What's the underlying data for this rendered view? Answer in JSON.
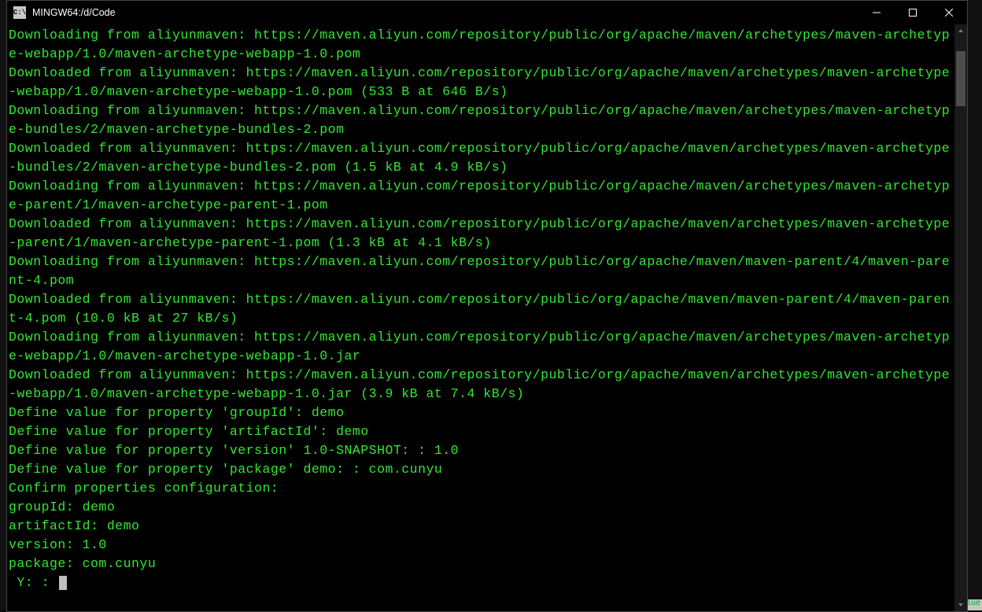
{
  "titlebar": {
    "icon_label": "C:\\",
    "title": "MINGW64:/d/Code"
  },
  "terminal": {
    "lines": [
      "Downloading from aliyunmaven: https://maven.aliyun.com/repository/public/org/apache/maven/archetypes/maven-archetype-webapp/1.0/maven-archetype-webapp-1.0.pom",
      "Downloaded from aliyunmaven: https://maven.aliyun.com/repository/public/org/apache/maven/archetypes/maven-archetype-webapp/1.0/maven-archetype-webapp-1.0.pom (533 B at 646 B/s)",
      "Downloading from aliyunmaven: https://maven.aliyun.com/repository/public/org/apache/maven/archetypes/maven-archetype-bundles/2/maven-archetype-bundles-2.pom",
      "Downloaded from aliyunmaven: https://maven.aliyun.com/repository/public/org/apache/maven/archetypes/maven-archetype-bundles/2/maven-archetype-bundles-2.pom (1.5 kB at 4.9 kB/s)",
      "Downloading from aliyunmaven: https://maven.aliyun.com/repository/public/org/apache/maven/archetypes/maven-archetype-parent/1/maven-archetype-parent-1.pom",
      "Downloaded from aliyunmaven: https://maven.aliyun.com/repository/public/org/apache/maven/archetypes/maven-archetype-parent/1/maven-archetype-parent-1.pom (1.3 kB at 4.1 kB/s)",
      "Downloading from aliyunmaven: https://maven.aliyun.com/repository/public/org/apache/maven/maven-parent/4/maven-parent-4.pom",
      "Downloaded from aliyunmaven: https://maven.aliyun.com/repository/public/org/apache/maven/maven-parent/4/maven-parent-4.pom (10.0 kB at 27 kB/s)",
      "Downloading from aliyunmaven: https://maven.aliyun.com/repository/public/org/apache/maven/archetypes/maven-archetype-webapp/1.0/maven-archetype-webapp-1.0.jar",
      "Downloaded from aliyunmaven: https://maven.aliyun.com/repository/public/org/apache/maven/archetypes/maven-archetype-webapp/1.0/maven-archetype-webapp-1.0.jar (3.9 kB at 7.4 kB/s)",
      "Define value for property 'groupId': demo",
      "Define value for property 'artifactId': demo",
      "Define value for property 'version' 1.0-SNAPSHOT: : 1.0",
      "Define value for property 'package' demo: : com.cunyu",
      "Confirm properties configuration:",
      "groupId: demo",
      "artifactId: demo",
      "version: 1.0",
      "package: com.cunyu",
      " Y: : "
    ]
  },
  "background": {
    "bottom_label": "Define value"
  }
}
